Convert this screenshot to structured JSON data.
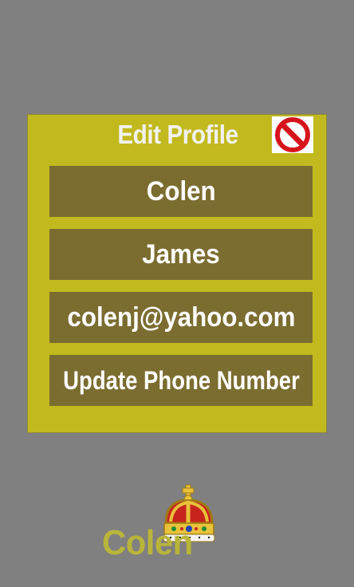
{
  "dialog": {
    "title": "Edit Profile",
    "close_icon": "no-entry-icon",
    "fields": {
      "first_name": "Colen",
      "last_name": "James",
      "email": "colenj@yahoo.com",
      "phone": "Update Phone Number"
    }
  },
  "logo": {
    "text": "Colen",
    "icon": "crown-icon"
  },
  "colors": {
    "background": "#808080",
    "dialog": "#c2b91f",
    "field": "#7b6d30",
    "logo_text": "#b8b53a",
    "close_red": "#d6141c"
  }
}
